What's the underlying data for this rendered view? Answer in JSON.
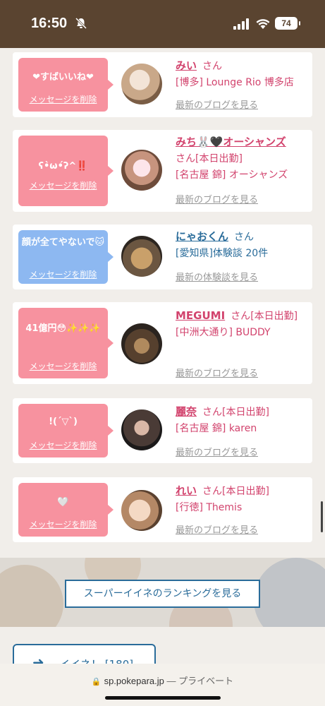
{
  "status_bar": {
    "time": "16:50",
    "battery": "74"
  },
  "delete_label": "メッセージを削除",
  "san": "さん",
  "entries": [
    {
      "message": "❤すばいいね❤",
      "name": "みい",
      "san_suffix": "",
      "detail": "[博多] Lounge Rio 博多店",
      "link": "最新のブログを見る"
    },
    {
      "message": "ʕ•̀ω•́ʔ^‼️",
      "name": "みち🐰🖤オーシャンズ",
      "san_suffix": "[本日出勤]",
      "detail": "[名古屋 錦] オーシャンズ",
      "link": "最新のブログを見る"
    },
    {
      "message": "顔が全てやないで🐱",
      "name": "にゃおくん",
      "san_suffix": "",
      "detail": "[愛知県]体験談 20件",
      "link": "最新の体験談を見る"
    },
    {
      "message": "41億円😳✨✨✨",
      "name": "MEGUMI",
      "san_suffix": "[本日出勤]",
      "detail": "[中洲大通り] BUDDY",
      "link": "最新のブログを見る"
    },
    {
      "message": "!(´▽`)",
      "name": "麗奈",
      "san_suffix": "[本日出勤]",
      "detail": "[名古屋 錦] karen",
      "link": "最新のブログを見る"
    },
    {
      "message": "🤍",
      "name": "れい",
      "san_suffix": "[本日出勤]",
      "detail": "[行徳] Themis",
      "link": "最新のブログを見る"
    }
  ],
  "ranking_button": "スーパーイイネのランキングを見る",
  "iine_button": "イイネ！ [180]",
  "address": {
    "domain": "sp.pokepara.jp",
    "private": "— プライベート"
  },
  "colors": {
    "status_bar": "#5a4430",
    "pink": "#f7929f",
    "blue": "#8db8f1",
    "name_pink": "#d2436d",
    "name_blue": "#2a6c9a"
  }
}
